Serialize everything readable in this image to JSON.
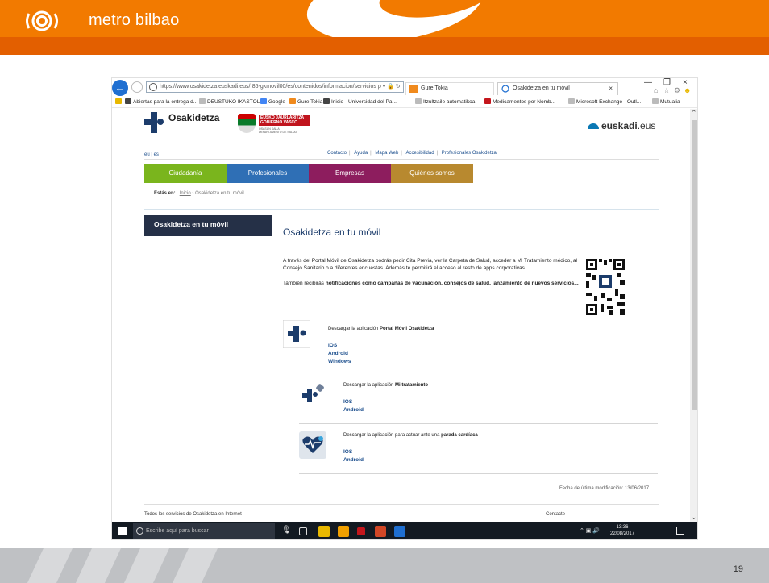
{
  "slide": {
    "brand": "metro bilbao",
    "page_number": "19"
  },
  "browser": {
    "url": "https://www.osakidetza.euskadi.eus/r85-gkmovil00/es/contenidos/informacion/servicios",
    "url_suffix": "ρ ▾ 🔒 ↻",
    "tabs": [
      {
        "label": "Gure Tokia"
      },
      {
        "label": "Osakidetza en tu móvil"
      }
    ],
    "favorites": [
      "Abiertas para la entrega d...",
      "DEUSTUKO IKASTOLA",
      "Google",
      "Gure Tokia",
      "Inicio - Universidad del Pa...",
      "Itzultzaile automatikoa",
      "Medicamentos por Nomb...",
      "Microsoft Exchange - Outl...",
      "Mutualia"
    ]
  },
  "site": {
    "osakidetza_logo": "Osakidetza",
    "gv_logo_line1": "EUSKO JAURLARITZA",
    "gv_logo_line2": "GOBIERNO VASCO",
    "gv_logo_sub1": "OSASUN SAILA",
    "gv_logo_sub2": "DEPARTAMENTO DE SALUD",
    "euskadi_logo_bold": "euskadi",
    "euskadi_logo_suffix": ".eus",
    "lang_eu": "eu",
    "lang_es": "es",
    "toplinks": [
      "Contacto",
      "Ayuda",
      "Mapa Web",
      "Accesibilidad",
      "Profesionales Osakidetza"
    ],
    "nav": [
      {
        "label": "Ciudadanía",
        "color": "#7ab51d"
      },
      {
        "label": "Profesionales",
        "color": "#2f6fb5"
      },
      {
        "label": "Empresas",
        "color": "#8d1d5e"
      },
      {
        "label": "Quiénes somos",
        "color": "#b8892f"
      }
    ],
    "breadcrumb_label": "Estás en:",
    "breadcrumb_home": "Inicio",
    "breadcrumb_sep": "›",
    "breadcrumb_current": "Osakidetza en tu móvil",
    "sidebar_title": "Osakidetza en tu móvil",
    "page_title": "Osakidetza en tu móvil",
    "intro": "A través del Portal Móvil de Osakidetza podrás pedir Cita Previa, ver la Carpeta de Salud, acceder a Mi Tratamiento médico, al Consejo Sanitario o a diferentes encuestas. Además te permitirá el acceso al resto de apps corporativas.",
    "intro2_prefix": "También recibirás ",
    "intro2_bold": "notificaciones como campañas de vacunación, consejos de salud, lanzamiento de nuevos servicios...",
    "apps": [
      {
        "desc_prefix": "Descargar la aplicación ",
        "desc_bold": "Portal Móvil Osakidetza",
        "desc_suffix": "",
        "links": [
          "IOS",
          "Android",
          "Windows"
        ]
      },
      {
        "desc_prefix": "Descargar la aplicación ",
        "desc_bold": "Mi tratamiento",
        "desc_suffix": "",
        "links": [
          "IOS",
          "Android"
        ]
      },
      {
        "desc_prefix": "Descargar la aplicación para actuar ante una ",
        "desc_bold": "parada cardíaca",
        "desc_suffix": "",
        "links": [
          "IOS",
          "Android"
        ]
      }
    ],
    "last_modified": "Fecha de última modificación: 13/06/2017",
    "footer_left": "Todos los servicios de Osakidetza en Internet",
    "footer_right": "Contacte"
  },
  "taskbar": {
    "search_placeholder": "Escribe aquí para buscar",
    "time": "13:36",
    "date": "22/08/2017"
  },
  "colors": {
    "header_orange": "#f27a00",
    "nav_blue": "#1c3c6b",
    "link_blue": "#1a4d8c",
    "sidebar_dark": "#253047"
  }
}
